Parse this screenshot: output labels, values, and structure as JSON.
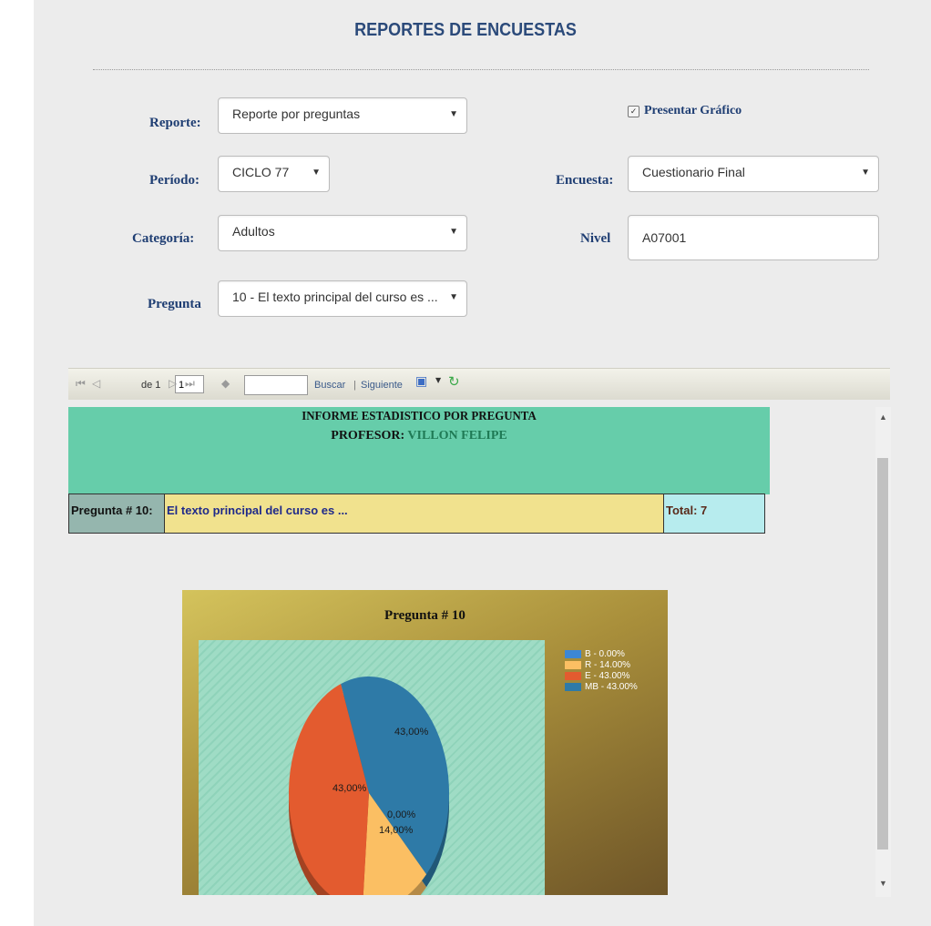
{
  "title": "REPORTES DE ENCUESTAS",
  "form": {
    "reporte_label": "Reporte:",
    "reporte_value": "Reporte por preguntas",
    "presentar_grafico": "Presentar Gráfico",
    "presentar_grafico_checked": true,
    "periodo_label": "Período:",
    "periodo_value": "CICLO 77",
    "encuesta_label": "Encuesta:",
    "encuesta_value": "Cuestionario Final",
    "categoria_label": "Categoría:",
    "categoria_value": "Adultos",
    "nivel_label": "Nivel",
    "nivel_value": "A07001",
    "pregunta_label": "Pregunta",
    "pregunta_value": "10 - El texto principal del curso es ..."
  },
  "toolbar": {
    "page_value": "1",
    "page_of": "de 1",
    "find_label": "Buscar",
    "separator": "|",
    "next_label": "Siguiente"
  },
  "report": {
    "heading": "INFORME ESTADISTICO POR PREGUNTA",
    "profesor_label": "PROFESOR:",
    "profesor_name": "VILLON  FELIPE",
    "question_num": "Pregunta # 10:",
    "question_text": "El texto principal del curso es ...",
    "total": "Total: 7"
  },
  "colors": {
    "B": "#3d87d6",
    "R": "#fbbf63",
    "E": "#e35b2f",
    "MB": "#2e7aa7"
  },
  "chart_data": {
    "type": "pie",
    "title": "Pregunta # 10",
    "categories": [
      "B",
      "R",
      "E",
      "MB"
    ],
    "values": [
      0.0,
      14.0,
      43.0,
      43.0
    ],
    "legend": [
      "B - 0.00%",
      "R - 14.00%",
      "E - 43.00%",
      "MB - 43.00%"
    ],
    "data_labels": [
      "0,00%",
      "14,00%",
      "43,00%",
      "43,00%"
    ],
    "legend_position": "right"
  }
}
